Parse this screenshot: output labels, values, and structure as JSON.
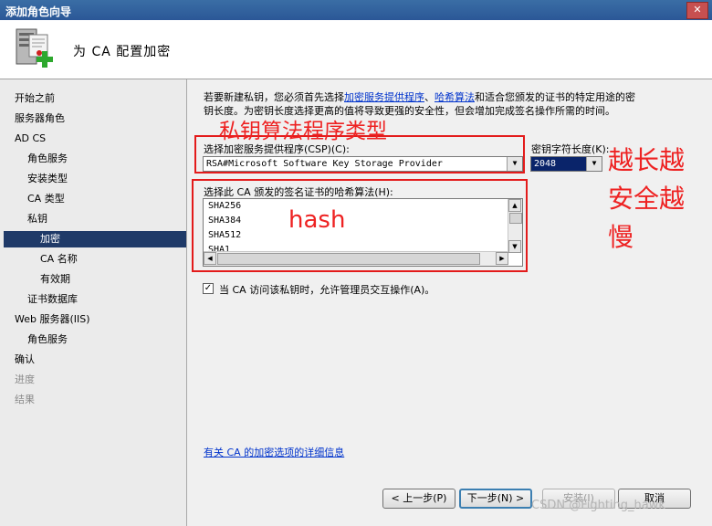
{
  "window": {
    "title": "添加角色向导",
    "close_label": "✕"
  },
  "header": {
    "title": "为 CA 配置加密"
  },
  "sidebar": {
    "items": [
      {
        "label": "开始之前"
      },
      {
        "label": "服务器角色"
      },
      {
        "label": "AD CS"
      },
      {
        "label": "角色服务"
      },
      {
        "label": "安装类型"
      },
      {
        "label": "CA 类型"
      },
      {
        "label": "私钥"
      },
      {
        "label": "加密"
      },
      {
        "label": "CA 名称"
      },
      {
        "label": "有效期"
      },
      {
        "label": "证书数据库"
      },
      {
        "label": "Web 服务器(IIS)"
      },
      {
        "label": "角色服务"
      },
      {
        "label": "确认"
      },
      {
        "label": "进度"
      },
      {
        "label": "结果"
      }
    ],
    "active_item": "加密"
  },
  "main": {
    "description": {
      "line1_pre": "若要新建私钥，您必须首先选择",
      "link1": "加密服务提供程序",
      "sep": "、",
      "link2": "哈希算法",
      "line1_post": "和适合您颁发的证书的特定用途的密",
      "line2": "钥长度。为密钥长度选择更高的值将导致更强的安全性，但会增加完成签名操作所需的时间。"
    },
    "csp": {
      "label": "选择加密服务提供程序(CSP)(C):",
      "value": "RSA#Microsoft Software Key Storage Provider"
    },
    "key_length": {
      "label": "密钥字符长度(K):",
      "value": "2048"
    },
    "hash": {
      "label": "选择此 CA 颁发的签名证书的哈希算法(H):",
      "options": [
        "SHA256",
        "SHA384",
        "SHA512",
        "SHA1"
      ]
    },
    "allow_interaction": {
      "label": "当 CA 访问该私钥时，允许管理员交互操作(A)。",
      "checked": true,
      "check_glyph": "✓"
    },
    "more_info_link": "有关 CA 的加密选项的详细信息"
  },
  "buttons": {
    "back": "< 上一步(P)",
    "next": "下一步(N) >",
    "install": "安装(I)",
    "cancel": "取消"
  },
  "annotations": {
    "csp_note": "私钥算法程序类型",
    "hash_note": "hash",
    "length_note": [
      "越长越",
      "安全越",
      "慢"
    ],
    "color": "#ee2222"
  },
  "watermark": "CSDN @Fighting_hawk"
}
